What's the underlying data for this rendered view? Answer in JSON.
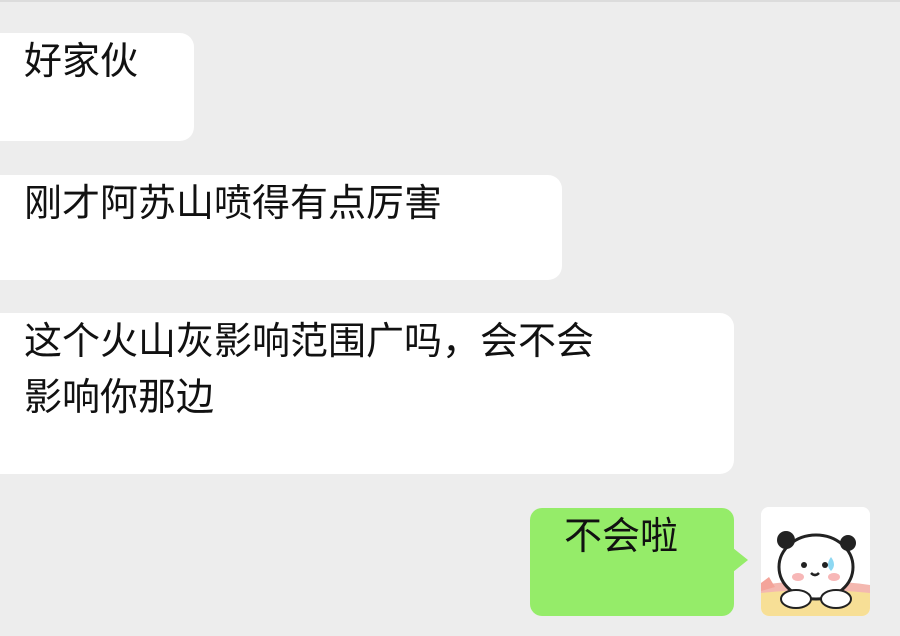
{
  "chat": {
    "messages": [
      {
        "direction": "incoming",
        "lines": [
          "好家伙"
        ]
      },
      {
        "direction": "incoming",
        "lines": [
          "刚才阿苏山喷得有点厉害"
        ]
      },
      {
        "direction": "incoming",
        "lines": [
          "这个火山灰影响范围广吗，会不会",
          "影响你那边"
        ]
      },
      {
        "direction": "outgoing",
        "lines": [
          "不会啦"
        ]
      }
    ]
  },
  "avatar": {
    "icon": "bear-sticker-avatar-icon"
  },
  "colors": {
    "background": "#ededed",
    "incoming_bubble": "#ffffff",
    "outgoing_bubble": "#95ec69",
    "text": "#111111"
  }
}
